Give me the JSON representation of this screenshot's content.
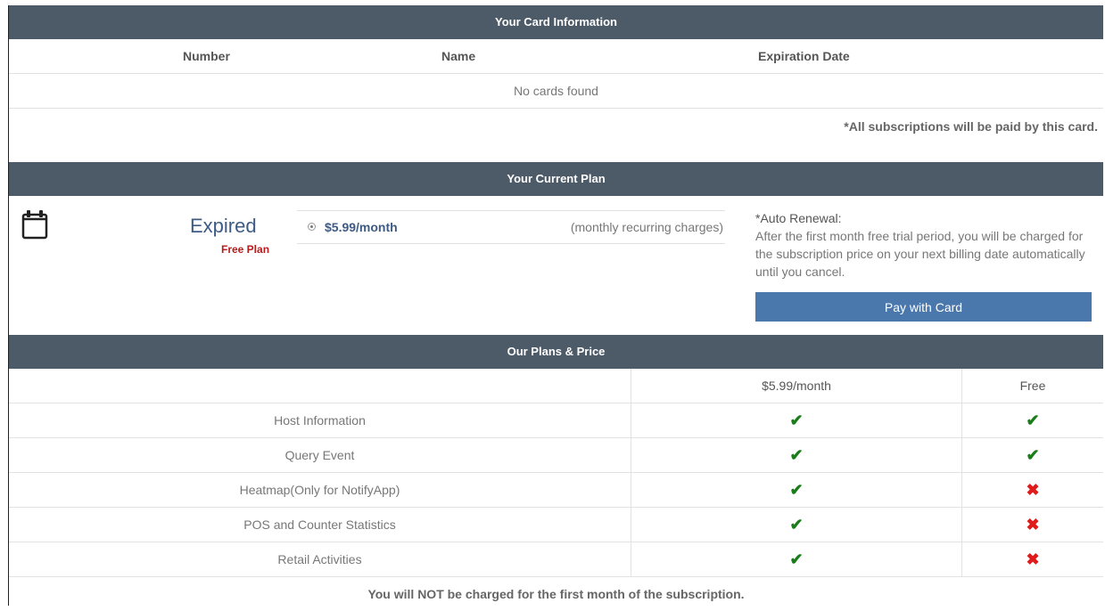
{
  "card_section": {
    "header": "Your Card Information",
    "columns": [
      "Number",
      "Name",
      "Expiration Date"
    ],
    "empty_text": "No cards found",
    "note": "*All subscriptions will be paid by this card."
  },
  "plan_section": {
    "header": "Your Current Plan",
    "status": "Expired",
    "plan_name": "Free Plan",
    "option_price": "$5.99/month",
    "option_desc": "(monthly recurring charges)",
    "auto_renewal_title": "*Auto Renewal:",
    "auto_renewal_text": "After the first month free trial period, you will be charged for the subscription price on your next billing date automatically until you cancel.",
    "pay_button": "Pay with Card"
  },
  "plans_section": {
    "header": "Our Plans & Price",
    "col_paid": "$5.99/month",
    "col_free": "Free",
    "features": [
      {
        "name": "Host Information",
        "paid": true,
        "free": true
      },
      {
        "name": "Query Event",
        "paid": true,
        "free": true
      },
      {
        "name": "Heatmap(Only for NotifyApp)",
        "paid": true,
        "free": false
      },
      {
        "name": "POS and Counter Statistics",
        "paid": true,
        "free": false
      },
      {
        "name": "Retail Activities",
        "paid": true,
        "free": false
      }
    ],
    "footer": "You will NOT be charged for the first month of the subscription."
  },
  "icons": {
    "check": "✔",
    "cross": "✖"
  },
  "colors": {
    "header_bg": "#4d5a68",
    "accent": "#3d5b85",
    "button": "#4a78ad",
    "check": "#1a7d1a",
    "cross": "#e01b1b",
    "expired_label": "#b91a1a"
  }
}
